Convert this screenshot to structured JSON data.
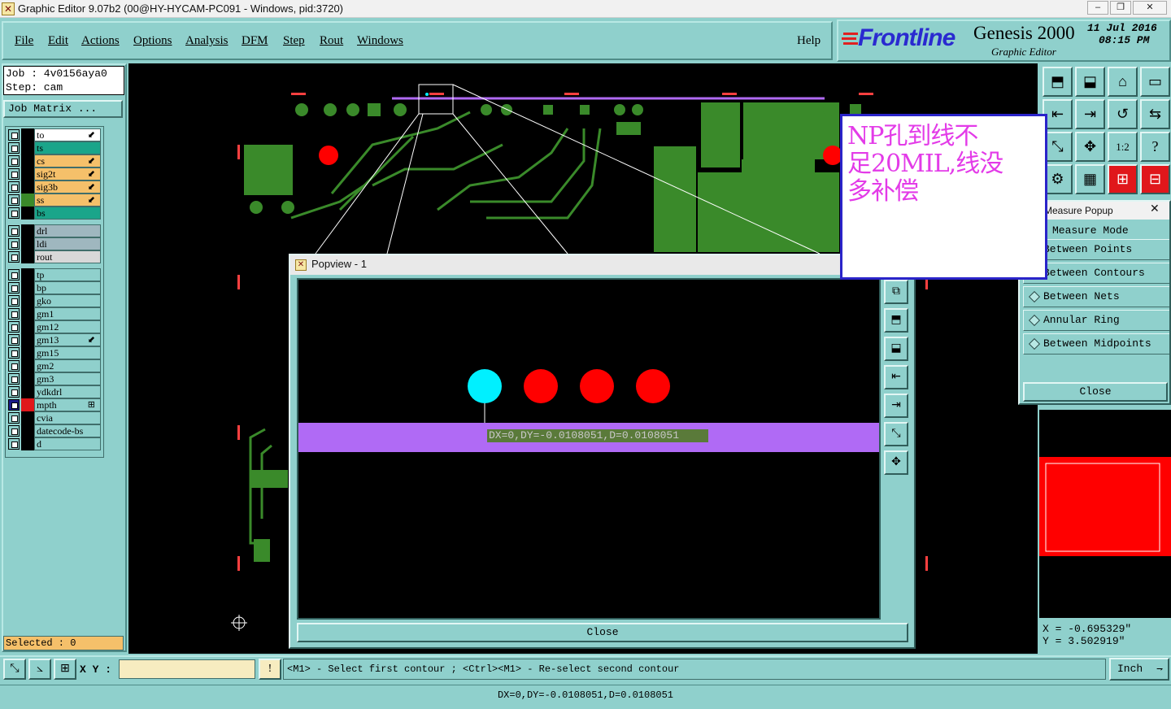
{
  "window": {
    "title": "Graphic Editor 9.07b2 (00@HY-HYCAM-PC091 - Windows, pid:3720)",
    "min": "–",
    "restore": "❐",
    "close": "✕"
  },
  "menu": {
    "items": [
      "File",
      "Edit",
      "Actions",
      "Options",
      "Analysis",
      "DFM",
      "Step",
      "Rout",
      "Windows"
    ],
    "help": "Help"
  },
  "brand": {
    "logo": "Frontline",
    "product": "Genesis 2000",
    "subtitle": "Graphic Editor",
    "date": "11 Jul 2016",
    "time": "08:15 PM"
  },
  "job": {
    "line1": "Job : 4v0156aya0",
    "line2": "Step: cam",
    "matrix": "Job Matrix ..."
  },
  "layers": [
    {
      "name": "to",
      "color": "#ffffff",
      "swatch": "#000000",
      "flag": "⬋"
    },
    {
      "name": "ts",
      "color": "#1aa58a",
      "swatch": "#000000",
      "flag": ""
    },
    {
      "name": "cs",
      "color": "#f5c06a",
      "swatch": "#000000",
      "flag": "⬋"
    },
    {
      "name": "sig2t",
      "color": "#f5c06a",
      "swatch": "#000000",
      "flag": "⬋"
    },
    {
      "name": "sig3b",
      "color": "#f5c06a",
      "swatch": "#000000",
      "flag": "⬋"
    },
    {
      "name": "ss",
      "color": "#f5c06a",
      "swatch": "#3a8a2a",
      "flag": "⬋"
    },
    {
      "name": "bs",
      "color": "#1aa58a",
      "swatch": "#000000",
      "flag": ""
    },
    {
      "name": "drl",
      "color": "#9fb7bf",
      "swatch": "#000000",
      "flag": ""
    },
    {
      "name": "ldi",
      "color": "#9fb7bf",
      "swatch": "#000000",
      "flag": ""
    },
    {
      "name": "rout",
      "color": "#d8d8d8",
      "swatch": "#000000",
      "flag": ""
    },
    {
      "name": "tp",
      "color": "#8fd0cc",
      "swatch": "#000000",
      "flag": ""
    },
    {
      "name": "bp",
      "color": "#8fd0cc",
      "swatch": "#000000",
      "flag": ""
    },
    {
      "name": "gko",
      "color": "#8fd0cc",
      "swatch": "#000000",
      "flag": ""
    },
    {
      "name": "gm1",
      "color": "#8fd0cc",
      "swatch": "#000000",
      "flag": ""
    },
    {
      "name": "gm12",
      "color": "#8fd0cc",
      "swatch": "#000000",
      "flag": ""
    },
    {
      "name": "gm13",
      "color": "#8fd0cc",
      "swatch": "#000000",
      "flag": "⬋"
    },
    {
      "name": "gm15",
      "color": "#8fd0cc",
      "swatch": "#000000",
      "flag": ""
    },
    {
      "name": "gm2",
      "color": "#8fd0cc",
      "swatch": "#000000",
      "flag": ""
    },
    {
      "name": "gm3",
      "color": "#8fd0cc",
      "swatch": "#000000",
      "flag": ""
    },
    {
      "name": "ydkdrl",
      "color": "#8fd0cc",
      "swatch": "#000000",
      "flag": ""
    },
    {
      "name": "mpth",
      "color": "#8fd0cc",
      "swatch": "#e0171b",
      "flag": "⊞",
      "boxColor": "#1a1a8a"
    },
    {
      "name": "cvia",
      "color": "#8fd0cc",
      "swatch": "#000000",
      "flag": ""
    },
    {
      "name": "datecode-bs",
      "color": "#8fd0cc",
      "swatch": "#000000",
      "flag": ""
    },
    {
      "name": "d",
      "color": "#8fd0cc",
      "swatch": "#000000",
      "flag": ""
    }
  ],
  "selected": "Selected : 0",
  "measure": {
    "title": "Measure Popup",
    "mode": "Measure Mode",
    "options": [
      "Between Points",
      "Between Contours",
      "Between Nets",
      "Annular Ring",
      "Between Midpoints"
    ],
    "close": "Close"
  },
  "coords": {
    "x": "X = -0.695329\"",
    "y": "Y = 3.502919\""
  },
  "popview": {
    "title": "Popview - 1",
    "measurement": "DX=0,DY=-0.0108051,D=0.0108051",
    "close": "Close"
  },
  "note": {
    "lines": [
      "NP孔到线不",
      "足20MIL,线没",
      "多补偿"
    ]
  },
  "status": {
    "xy_label": "X Y :",
    "xy_value": "",
    "alert": "!",
    "message": "<M1> - Select first contour ; <Ctrl><M1> - Re-select second contour",
    "units": "Inch"
  },
  "bottom": {
    "message": "DX=0,DY=-0.0108051,D=0.0108051"
  },
  "tools": [
    "⬒",
    "⬓",
    "⌂",
    "▭",
    "⇤",
    "⇥",
    "↺",
    "⇆",
    "⤡",
    "✥",
    "1:2",
    "?",
    "⚙",
    "▦",
    "⊞",
    "⊟"
  ],
  "colors": {
    "green": "#3a8a2a",
    "red": "#ff0000",
    "cyan": "#00f0ff",
    "purple": "#b06af5",
    "teal": "#8fd0cc"
  }
}
